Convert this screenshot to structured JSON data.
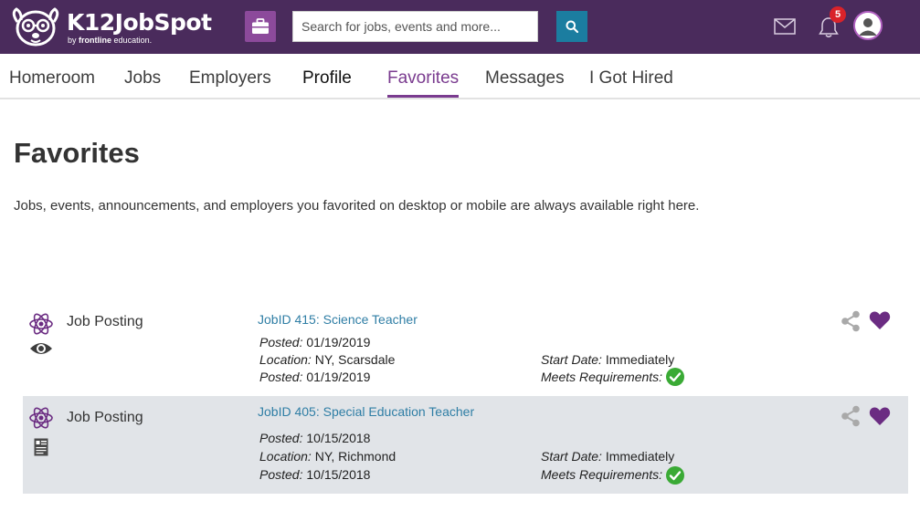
{
  "header": {
    "logo_name": "K12JobSpot",
    "logo_by": "by",
    "logo_brand": "frontline",
    "logo_suffix": "education.",
    "search": {
      "placeholder": "Search for jobs, events and more..."
    },
    "notifications_count": "5",
    "colors": {
      "bar": "#4a2b5c",
      "briefcase": "#8c4a9b",
      "search_button": "#1b7da0",
      "badge": "#d9232a"
    }
  },
  "nav": {
    "tabs": [
      {
        "label": "Homeroom"
      },
      {
        "label": "Jobs"
      },
      {
        "label": "Employers"
      },
      {
        "label": "Profile"
      },
      {
        "label": "Favorites",
        "active": true
      },
      {
        "label": "Messages"
      },
      {
        "label": "I Got Hired"
      }
    ]
  },
  "page": {
    "title": "Favorites",
    "description": "Jobs, events, announcements, and employers you favorited on desktop or mobile are always available right here."
  },
  "favorites": [
    {
      "type": "Job Posting",
      "status_icon": "eye-icon",
      "link": "JobID 415: Science Teacher",
      "posted_label": "Posted:",
      "posted": "01/19/2019",
      "location_label": "Location:",
      "location": "NY, Scarsdale",
      "posted2_label": "Posted:",
      "posted2": "01/19/2019",
      "start_label": "Start Date:",
      "start": "Immediately",
      "meets_label": "Meets Requirements:"
    },
    {
      "type": "Job Posting",
      "status_icon": "resume-icon",
      "link": "JobID 405: Special Education Teacher",
      "posted_label": "Posted:",
      "posted": "10/15/2018",
      "location_label": "Location:",
      "location": "NY, Richmond",
      "posted2_label": "Posted:",
      "posted2": "10/15/2018",
      "start_label": "Start Date:",
      "start": "Immediately",
      "meets_label": "Meets Requirements:"
    }
  ],
  "colors": {
    "accent": "#7a3b8f",
    "link": "#2f7ea5",
    "check": "#3aaa35",
    "heart": "#6b2c82",
    "row_alt": "#e1e4e8"
  }
}
